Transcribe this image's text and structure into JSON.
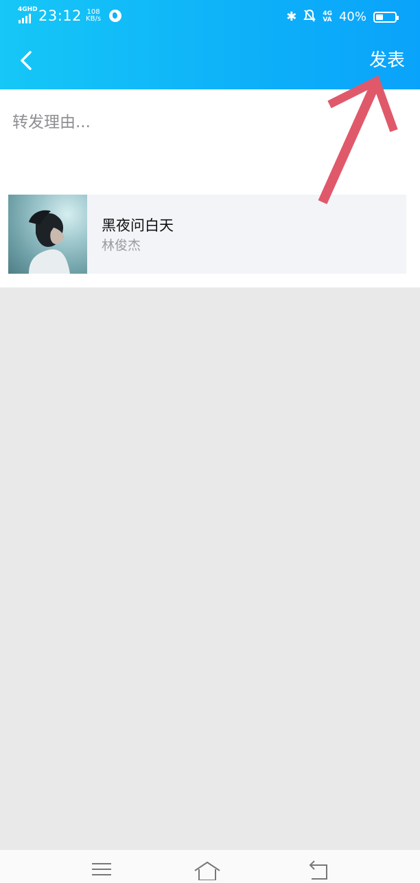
{
  "status_bar": {
    "network": "4GHD",
    "time": "23:12",
    "speed_value": "108",
    "speed_unit": "KB/s",
    "net4g_top": "4G",
    "net4g_bottom": "VA",
    "battery_percent": "40%",
    "battery_level": 0.4
  },
  "header": {
    "back_icon": "chevron-left-icon",
    "publish_label": "发表",
    "accent_color": "#0eb2f8"
  },
  "compose": {
    "reason_value": "",
    "reason_placeholder": "转发理由..."
  },
  "shared_song": {
    "title": "黑夜问白天",
    "artist": "林俊杰"
  },
  "annotation": {
    "arrow_color": "#e0596a"
  },
  "nav_bar": {
    "menu_icon": "menu-icon",
    "home_icon": "home-icon",
    "back_icon": "back-icon"
  }
}
